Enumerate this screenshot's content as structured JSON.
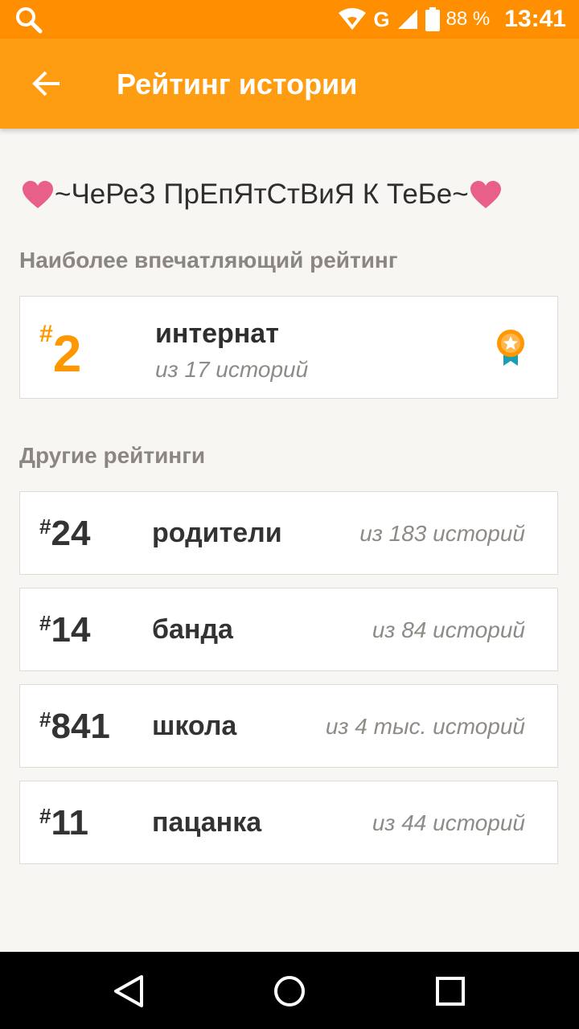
{
  "status_bar": {
    "network": "G",
    "battery": "88 %",
    "time": "13:41"
  },
  "app_bar": {
    "title": "Рейтинг истории",
    "back_icon": "arrow-left-icon"
  },
  "story_title": "~ЧеРеЗ ПрЕпЯтСтВиЯ К ТеБе~",
  "sections": {
    "top_label": "Наиболее впечатляющий рейтинг",
    "other_label": "Другие рейтинги"
  },
  "top_ranking": {
    "hash": "#",
    "rank": "2",
    "tag": "интернат",
    "subtitle": "из 17 историй",
    "icon": "medal-icon"
  },
  "other_rankings": [
    {
      "hash": "#",
      "rank": "24",
      "tag": "родители",
      "subtitle": "из 183 историй"
    },
    {
      "hash": "#",
      "rank": "14",
      "tag": "банда",
      "subtitle": "из 84 историй"
    },
    {
      "hash": "#",
      "rank": "841",
      "tag": "школа",
      "subtitle": "из 4 тыс. историй"
    },
    {
      "hash": "#",
      "rank": "11",
      "tag": "пацанка",
      "subtitle": "из 44 историй"
    }
  ],
  "colors": {
    "status_bar": "#ff8f00",
    "app_bar": "#ff9d12",
    "accent": "#ff9800",
    "heart": "#e8608a",
    "medal_ribbon": "#1a9fb0"
  }
}
